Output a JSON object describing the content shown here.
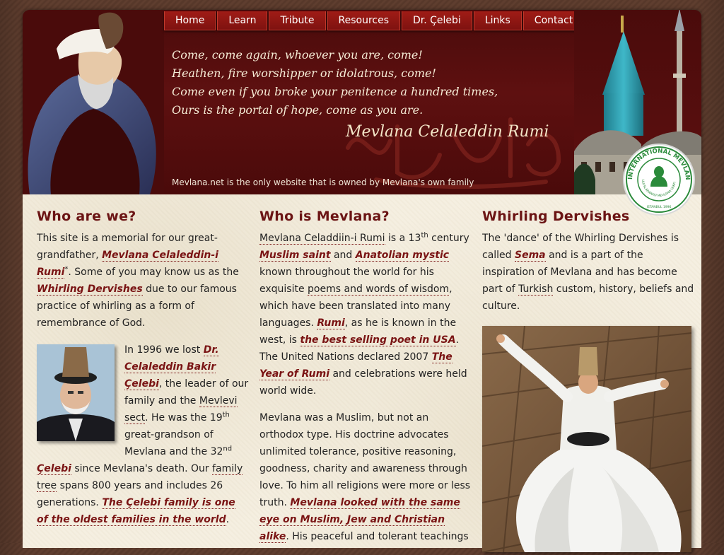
{
  "nav": {
    "items": [
      "Home",
      "Learn",
      "Tribute",
      "Resources",
      "Dr. Çelebi",
      "Links",
      "Contact"
    ]
  },
  "header": {
    "poem": [
      "Come, come again, whoever you are, come!",
      "Heathen, fire worshipper or idolatrous, come!",
      "Come even if you broke your penitence a hundred times,",
      "Ours is the portal of hope, come as you are."
    ],
    "signature": "Mevlana Celaleddin Rumi",
    "tagline": "Mevlana.net is the only website that is owned by Mevlana's own family"
  },
  "col1": {
    "title": "Who are we?",
    "p1": {
      "t1": "This site is a memorial for our great-grandfather, ",
      "l1": "Mevlana Celaleddin-i Rumi",
      "sup1": "*",
      "t2": ". Some of you may know us as the ",
      "l2": "Whirling Dervishes",
      "t3": " due to our famous practice of whirling as a form of remembrance of God."
    },
    "p2": {
      "t1": "In 1996 we lost ",
      "l1": "Dr. Celaleddin Bakir Çelebi",
      "t2": ", the leader of our family and the ",
      "l2": "Mevlevi sect",
      "t3": ". He was the 19",
      "sup1": "th",
      "t4": " great-grandson of Mevlana and the 32",
      "sup2": "nd",
      "t5": " ",
      "l3": "Çelebi",
      "t6": " since Mevlana's death. Our ",
      "l4": "family tree",
      "t7": " spans 800 years and includes 26 generations. ",
      "l5": "The Çelebi family is one of the oldest families in the world",
      "t8": "."
    }
  },
  "col2": {
    "title": "Who is Mevlana?",
    "p1": {
      "l1": "Mevlana Celaddiin-i Rumi",
      "t1": " is a 13",
      "sup1": "th",
      "t2": " century ",
      "l2": "Muslim saint",
      "t3": " and ",
      "l3": "Anatolian mystic",
      "t4": " known throughout the world for his exquisite ",
      "l4": "poems and words of wisdom",
      "t5": ", which have been translated into many languages. ",
      "l5": "Rumi",
      "t6": ", as he is known in the west, is ",
      "l6": "the best selling poet in USA",
      "t7": ". The United Nations declared 2007 ",
      "l7": "The Year of Rumi",
      "t8": " and celebrations were held world wide."
    },
    "p2": {
      "t1": "Mevlana was a Muslim, but not an orthodox type. His doctrine advocates unlimited tolerance, positive reasoning, goodness, charity and awareness through love. To him all religions were more or less truth. ",
      "l1": "Mevlana looked with the same eye on Muslim, Jew and Christian alike",
      "t2": ". His peaceful and tolerant teachings"
    }
  },
  "col3": {
    "title": "Whirling Dervishes",
    "p1": {
      "t1": "The 'dance' of the Whirling Dervishes is called ",
      "l1": "Sema",
      "t2": " and is a part of the inspiration of Mevlana and has become part of ",
      "l2": "Turkish",
      "t3": " custom, history, beliefs and culture."
    }
  },
  "seal": {
    "ring_text": "INTERNATIONAL MEVLANA FOUNDATION",
    "inner_text": "ULUSLARARASI MEVLANA VAKFI",
    "year": "ISTANBUL 1996"
  },
  "colors": {
    "header_bg": "#5e1010",
    "nav_bg": "#8f1712",
    "heading": "#6b1414",
    "link_emphasis": "#7a1414",
    "content_bg": "#f5efe1",
    "dome": "#2fa3b5",
    "seal_green": "#2a8a3a"
  }
}
